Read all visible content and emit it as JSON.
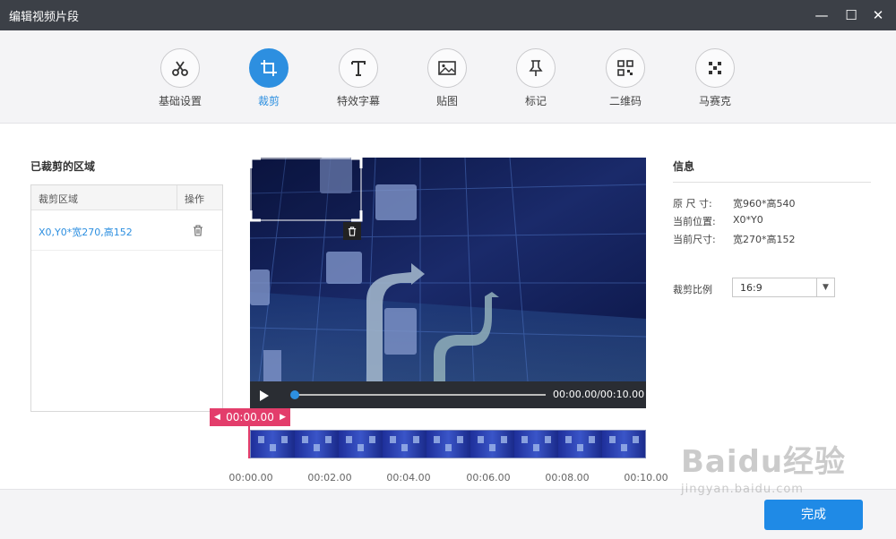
{
  "window": {
    "title": "编辑视频片段",
    "minimize_label": "—",
    "maximize_label": "☐",
    "close_label": "✕"
  },
  "toolbar": {
    "tools": [
      {
        "label": "基础设置",
        "icon": "scissors-icon"
      },
      {
        "label": "裁剪",
        "icon": "crop-icon",
        "active": true
      },
      {
        "label": "特效字幕",
        "icon": "text-icon"
      },
      {
        "label": "贴图",
        "icon": "image-icon"
      },
      {
        "label": "标记",
        "icon": "pin-icon"
      },
      {
        "label": "二维码",
        "icon": "qrcode-icon"
      },
      {
        "label": "马赛克",
        "icon": "mosaic-icon"
      }
    ]
  },
  "cropped": {
    "title": "已裁剪的区域",
    "header_area": "裁剪区域",
    "header_action": "操作",
    "rows": [
      {
        "value": "X0,Y0*宽270,高152"
      }
    ]
  },
  "player": {
    "time_display": "00:00.00/00:10.00",
    "current_badge": "00:00.00",
    "progress": 0.0
  },
  "timeline": {
    "ticks": [
      "00:00.00",
      "00:02.00",
      "00:04.00",
      "00:06.00",
      "00:08.00",
      "00:10.00"
    ]
  },
  "info": {
    "title": "信息",
    "original_size_label": "原 尺 寸:",
    "original_size_value": "宽960*高540",
    "position_label": "当前位置:",
    "position_value": "X0*Y0",
    "current_size_label": "当前尺寸:",
    "current_size_value": "宽270*高152",
    "ratio_label": "裁剪比例",
    "ratio_value": "16:9"
  },
  "footer": {
    "done_label": "完成"
  },
  "watermark": {
    "logo": "Baidu经验",
    "url": "jingyan.baidu.com"
  },
  "colors": {
    "accent": "#2d8fe0",
    "badge": "#e33d6b",
    "titlebar": "#3c4047"
  }
}
